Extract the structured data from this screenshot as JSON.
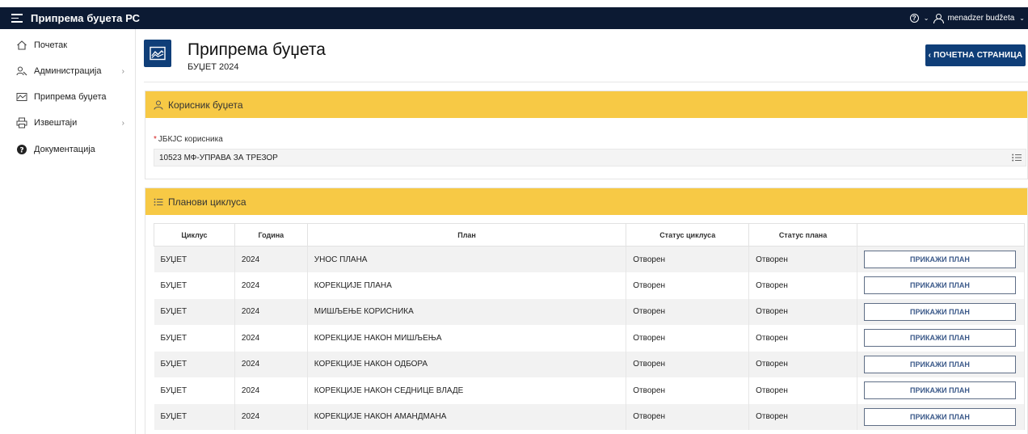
{
  "topbar": {
    "title": "Припрема буџета РС",
    "help_glyph": "?",
    "user_name": "menadzer budžeta"
  },
  "sidebar": {
    "items": [
      {
        "label": "Почетак",
        "icon": "home-icon"
      },
      {
        "label": "Администрација",
        "icon": "user-admin-icon"
      },
      {
        "label": "Припрема буџета",
        "icon": "chart-area-icon"
      },
      {
        "label": "Извештаји",
        "icon": "printer-icon"
      },
      {
        "label": "Документација",
        "icon": "question-circle-icon"
      }
    ]
  },
  "header": {
    "title": "Припрема буџета",
    "subtitle": "БУЏЕТ 2024",
    "home_button": "‹  ПОЧЕТНА СТРАНИЦА"
  },
  "user_section": {
    "title": "Корисник буџета",
    "field_label": "ЈБКЈС корисника",
    "field_value": "10523 МФ-УПРАВА ЗА ТРЕЗОР"
  },
  "plans_section": {
    "title": "Планови циклуса",
    "columns": [
      "Циклус",
      "Година",
      "План",
      "Статус циклуса",
      "Статус плана",
      ""
    ],
    "button_label": "ПРИКАЖИ ПЛАН",
    "rows": [
      {
        "cycle": "БУЏЕТ",
        "year": "2024",
        "plan": "УНОС ПЛАНА",
        "cycle_status": "Отворен",
        "plan_status": "Отворен"
      },
      {
        "cycle": "БУЏЕТ",
        "year": "2024",
        "plan": "КОРЕКЦИЈЕ ПЛАНА",
        "cycle_status": "Отворен",
        "plan_status": "Отворен"
      },
      {
        "cycle": "БУЏЕТ",
        "year": "2024",
        "plan": "МИШЉЕЊЕ КОРИСНИКА",
        "cycle_status": "Отворен",
        "plan_status": "Отворен"
      },
      {
        "cycle": "БУЏЕТ",
        "year": "2024",
        "plan": "КОРЕКЦИЈЕ НАКОН МИШЉЕЊА",
        "cycle_status": "Отворен",
        "plan_status": "Отворен"
      },
      {
        "cycle": "БУЏЕТ",
        "year": "2024",
        "plan": "КОРЕКЦИЈЕ НАКОН ОДБОРА",
        "cycle_status": "Отворен",
        "plan_status": "Отворен"
      },
      {
        "cycle": "БУЏЕТ",
        "year": "2024",
        "plan": "КОРЕКЦИЈЕ НАКОН СЕДНИЦЕ ВЛАДЕ",
        "cycle_status": "Отворен",
        "plan_status": "Отворен"
      },
      {
        "cycle": "БУЏЕТ",
        "year": "2024",
        "plan": "КОРЕКЦИЈЕ НАКОН АМАНДМАНА",
        "cycle_status": "Отворен",
        "plan_status": "Отворен"
      }
    ]
  },
  "colors": {
    "topbar": "#0c1a33",
    "primary": "#0f3e78",
    "section_header": "#f7c945",
    "required": "#d42020"
  }
}
